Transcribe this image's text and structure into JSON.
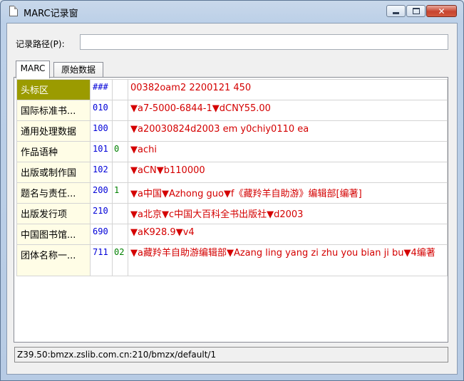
{
  "window": {
    "title": "MARC记录窗"
  },
  "form": {
    "path_label": "记录路径(P):",
    "path_value": ""
  },
  "tabs": [
    {
      "label": "MARC",
      "active": true
    },
    {
      "label": "原始数据",
      "active": false
    }
  ],
  "marc": {
    "rows": [
      {
        "name": "头标区",
        "tag": "###",
        "ind": "",
        "value": "00382oam2  2200121    450"
      },
      {
        "name": "国际标准书...",
        "tag": "010",
        "ind": "",
        "value": "▼a7-5000-6844-1▼dCNY55.00"
      },
      {
        "name": "通用处理数据",
        "tag": "100",
        "ind": "",
        "value": "▼a20030824d2003    em y0chiy0110    ea"
      },
      {
        "name": "作品语种",
        "tag": "101",
        "ind": "0",
        "value": "▼achi"
      },
      {
        "name": "出版或制作国",
        "tag": "102",
        "ind": "",
        "value": "▼aCN▼b110000"
      },
      {
        "name": "题名与责任...",
        "tag": "200",
        "ind": "1",
        "value": "▼a中国▼Azhong guo▼f《藏羚羊自助游》编辑部[编著]"
      },
      {
        "name": "出版发行项",
        "tag": "210",
        "ind": "",
        "value": "▼a北京▼c中国大百科全书出版社▼d2003"
      },
      {
        "name": "中国图书馆...",
        "tag": "690",
        "ind": "",
        "value": "▼aK928.9▼v4"
      },
      {
        "name": "团体名称一...",
        "tag": "711",
        "ind": "02",
        "value": "▼a藏羚羊自助游编辑部▼Azang ling yang zi zhu you bian ji bu▼4编著"
      }
    ]
  },
  "status": {
    "text": "Z39.50:bmzx.zslib.com.cn:210/bmzx/default/1"
  }
}
